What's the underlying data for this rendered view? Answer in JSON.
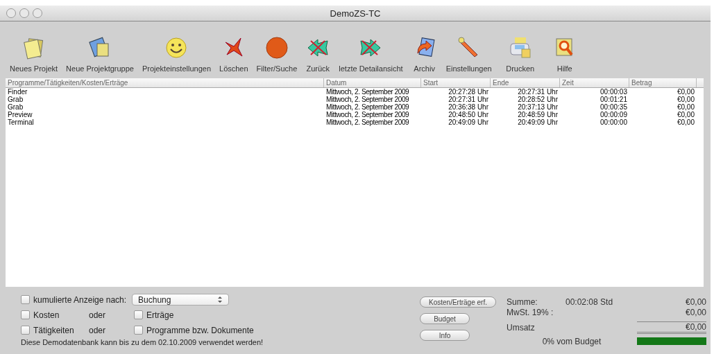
{
  "window": {
    "title": "DemoZS-TC"
  },
  "toolbar": [
    {
      "label": "Neues Projekt",
      "kind": "new-project"
    },
    {
      "label": "Neue Projektgruppe",
      "kind": "new-group"
    },
    {
      "label": "Projekteinstellungen",
      "kind": "smiley"
    },
    {
      "label": "Löschen",
      "kind": "delete"
    },
    {
      "label": "Filter/Suche",
      "kind": "filter"
    },
    {
      "label": "Zurück",
      "kind": "back"
    },
    {
      "label": "letzte Detailansicht",
      "kind": "forward"
    },
    {
      "label": "Archiv",
      "kind": "archive"
    },
    {
      "label": "Einstellungen",
      "kind": "settings"
    },
    {
      "label": "Drucken",
      "kind": "print"
    },
    {
      "label": "Hilfe",
      "kind": "help"
    }
  ],
  "table": {
    "columns": [
      "Programme/Tätigkeiten/Kosten/Erträge",
      "Datum",
      "Start",
      "Ende",
      "Zeit",
      "Betrag"
    ],
    "rows": [
      [
        "Finder",
        "Mittwoch, 2. September 2009",
        "20:27:28 Uhr",
        "20:27:31 Uhr",
        "00:00:03",
        "€0,00"
      ],
      [
        "Grab",
        "Mittwoch, 2. September 2009",
        "20:27:31 Uhr",
        "20:28:52 Uhr",
        "00:01:21",
        "€0,00"
      ],
      [
        "Grab",
        "Mittwoch, 2. September 2009",
        "20:36:38 Uhr",
        "20:37:13 Uhr",
        "00:00:35",
        "€0,00"
      ],
      [
        "Preview",
        "Mittwoch, 2. September 2009",
        "20:48:50 Uhr",
        "20:48:59 Uhr",
        "00:00:09",
        "€0,00"
      ],
      [
        "Terminal",
        "Mittwoch, 2. September 2009",
        "20:49:09 Uhr",
        "20:49:09 Uhr",
        "00:00:00",
        "€0,00"
      ]
    ]
  },
  "options": {
    "cumulative": {
      "label": "kumulierte Anzeige nach:",
      "checked": false,
      "select_value": "Buchung"
    },
    "rows": [
      {
        "left": {
          "label": "Kosten",
          "checked": false
        },
        "connector": "oder",
        "right": {
          "label": "Erträge",
          "checked": false
        }
      },
      {
        "left": {
          "label": "Tätigkeiten",
          "checked": false
        },
        "connector": "oder",
        "right": {
          "label": "Programme bzw. Dokumente",
          "checked": false
        }
      }
    ],
    "notice": "Diese Demodatenbank kann bis zu dem 02.10.2009 verwendet werden!"
  },
  "buttons": [
    "Kosten/Erträge erf.",
    "Budget",
    "Info"
  ],
  "summary": {
    "sum_label": "Summe:",
    "sum_time": "00:02:08 Std",
    "sum_amount": "€0,00",
    "vat_label": "MwSt. 19% :",
    "vat_amount": "€0,00",
    "revenue_label": "Umsatz",
    "revenue_amount": "€0,00",
    "budget_label": "0% vom Budget"
  }
}
